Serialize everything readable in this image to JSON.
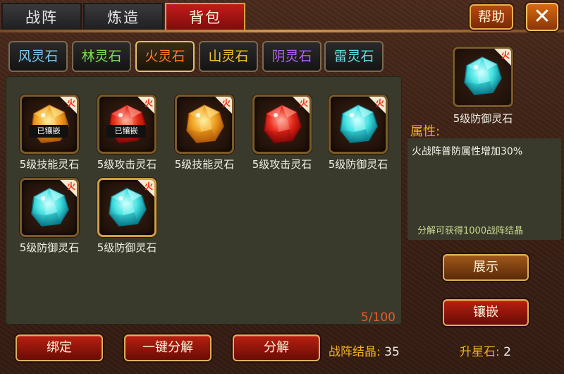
{
  "top_tabs": [
    {
      "label": "战阵",
      "active": false
    },
    {
      "label": "炼造",
      "active": false
    },
    {
      "label": "背包",
      "active": true
    }
  ],
  "help_label": "帮助",
  "close_label": "✕",
  "element_tabs": [
    {
      "label": "风灵石",
      "color": "#7ac8f0",
      "active": false
    },
    {
      "label": "林灵石",
      "color": "#7ae050",
      "active": false
    },
    {
      "label": "火灵石",
      "color": "#ff7a28",
      "active": true
    },
    {
      "label": "山灵石",
      "color": "#f0c030",
      "active": false
    },
    {
      "label": "阴灵石",
      "color": "#b060f0",
      "active": false
    },
    {
      "label": "雷灵石",
      "color": "#60e0e0",
      "active": false
    }
  ],
  "inventory": {
    "items": [
      {
        "name": "5级技能灵石",
        "gem": "gold",
        "embedded": "已镶嵌",
        "corner": "火"
      },
      {
        "name": "5级攻击灵石",
        "gem": "red",
        "embedded": "已镶嵌",
        "corner": "火"
      },
      {
        "name": "5级技能灵石",
        "gem": "gold",
        "embedded": "",
        "corner": "火"
      },
      {
        "name": "5级攻击灵石",
        "gem": "red",
        "embedded": "",
        "corner": "火"
      },
      {
        "name": "5级防御灵石",
        "gem": "cyan",
        "embedded": "",
        "corner": "火"
      },
      {
        "name": "5级防御灵石",
        "gem": "cyan",
        "embedded": "",
        "corner": "火"
      },
      {
        "name": "5级防御灵石",
        "gem": "cyan",
        "embedded": "",
        "corner": "火",
        "selected": true
      }
    ],
    "count": "5/100"
  },
  "detail": {
    "name": "5级防御灵石",
    "corner": "火",
    "attr_label": "属性:",
    "attr_text": "火战阵普防属性增加30%",
    "note": "分解可获得1000战阵结晶",
    "show_label": "展示",
    "embed_label": "镶嵌"
  },
  "bottom": {
    "bind_label": "绑定",
    "quick_decompose_label": "一键分解",
    "decompose_label": "分解",
    "crystal_label": "战阵结晶:",
    "crystal_value": "35",
    "star_label": "升星石:",
    "star_value": "2"
  },
  "gem_colors": {
    "gold": [
      "#fff0a0",
      "#f0a020",
      "#b05a08"
    ],
    "red": [
      "#ffb0a0",
      "#e82a1a",
      "#8a0808"
    ],
    "cyan": [
      "#d0ffff",
      "#40e0e0",
      "#0a7a8a"
    ]
  }
}
